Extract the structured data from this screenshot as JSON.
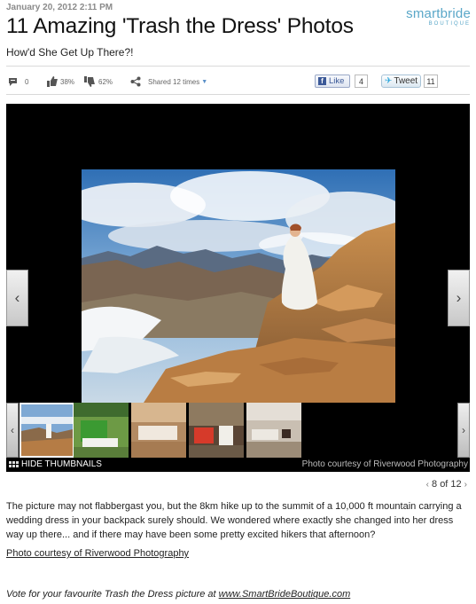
{
  "article": {
    "date": "January 20, 2012 2:11 PM",
    "title": "11 Amazing 'Trash the Dress' Photos",
    "subtitle": "How'd She Get Up There?!"
  },
  "brand": {
    "name": "smartbride",
    "tagline": "BOUTIQUE"
  },
  "social": {
    "comments": "0",
    "likes_pct": "38%",
    "dislikes_pct": "62%",
    "shared": "Shared 12 times",
    "fb_like": "Like",
    "fb_count": "4",
    "tweet": "Tweet",
    "tweet_count": "11"
  },
  "gallery": {
    "hide_thumbnails": "HIDE THUMBNAILS",
    "credit": "Photo courtesy of Riverwood Photography",
    "current": "8 of 12"
  },
  "body": {
    "text": "The picture may not flabbergast you, but the 8km hike up to the summit of a 10,000 ft mountain carrying a wedding dress in your backpack surely should. We wondered where exactly she changed into her dress way up there... and if there may have been some pretty excited hikers that afternoon?",
    "credit_link": "Photo courtesy of Riverwood Photography",
    "vote_text": "Vote for your favourite Trash the Dress picture at ",
    "vote_link": "www.SmartBrideBoutique.com"
  }
}
